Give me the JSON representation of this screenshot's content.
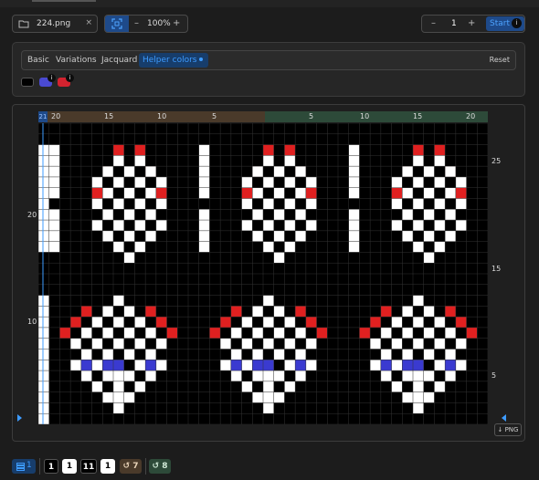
{
  "toolbar": {
    "file_name": "224.png",
    "file_clear": "×",
    "zoom_minus": "–",
    "zoom_value": "100%",
    "zoom_plus": "+",
    "step_minus": "–",
    "step_value": "1",
    "step_plus": "+",
    "start_label": "Start",
    "start_icon": "i"
  },
  "panel": {
    "tabs": [
      {
        "label": "Basic"
      },
      {
        "label": "Variations"
      },
      {
        "label": "Jacquard"
      },
      {
        "label": "Helper colors",
        "active": true
      }
    ],
    "reset_label": "Reset",
    "helper_swatches": [
      {
        "color": "#000000",
        "info": false
      },
      {
        "color": "#4a4ad2",
        "info": true,
        "info_label": "i"
      },
      {
        "color": "#d3232f",
        "info": true,
        "info_label": "i"
      }
    ]
  },
  "ruler": {
    "badge": "21",
    "left_ticks": [
      "20",
      "15",
      "10",
      "5"
    ],
    "right_ticks": [
      "5",
      "10",
      "15",
      "20"
    ]
  },
  "row_labels": {
    "left": [
      "20",
      "10"
    ],
    "right": [
      "25",
      "15",
      "5"
    ]
  },
  "export_label": "↓ PNG",
  "bottom": {
    "layers_label": "1",
    "color_counts": [
      "1",
      "1",
      "11",
      "1"
    ],
    "repeat_a": "7",
    "repeat_b": "8"
  },
  "colors": {
    "accent": "#3d9bff",
    "knit_white": "#ffffff",
    "knit_black": "#000000",
    "helper_red": "#e02020",
    "helper_blue": "#3a3ad0"
  }
}
